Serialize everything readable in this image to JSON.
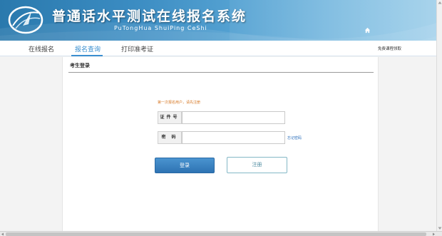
{
  "banner": {
    "title": "普通话水平测试在线报名系统",
    "subtitle": "PuTongHua ShuiPing CeShi"
  },
  "nav": {
    "items": [
      {
        "label": "在线报名",
        "active": false
      },
      {
        "label": "报名查询",
        "active": true
      },
      {
        "label": "打印准考证",
        "active": false
      }
    ],
    "right_link": "免费课程领取"
  },
  "login": {
    "section_title": "考生登录",
    "hint": "第一次报名用户，请先注册",
    "id_label": "证件号",
    "id_value": "",
    "password_label": "密 码",
    "password_value": "",
    "forgot_label": "忘记密码",
    "login_button": "登录",
    "register_button": "注册"
  },
  "colors": {
    "accent": "#3a8fd0",
    "hint": "#d77a28",
    "login_button": "#3a84c4",
    "register_border": "#84b8c6"
  }
}
